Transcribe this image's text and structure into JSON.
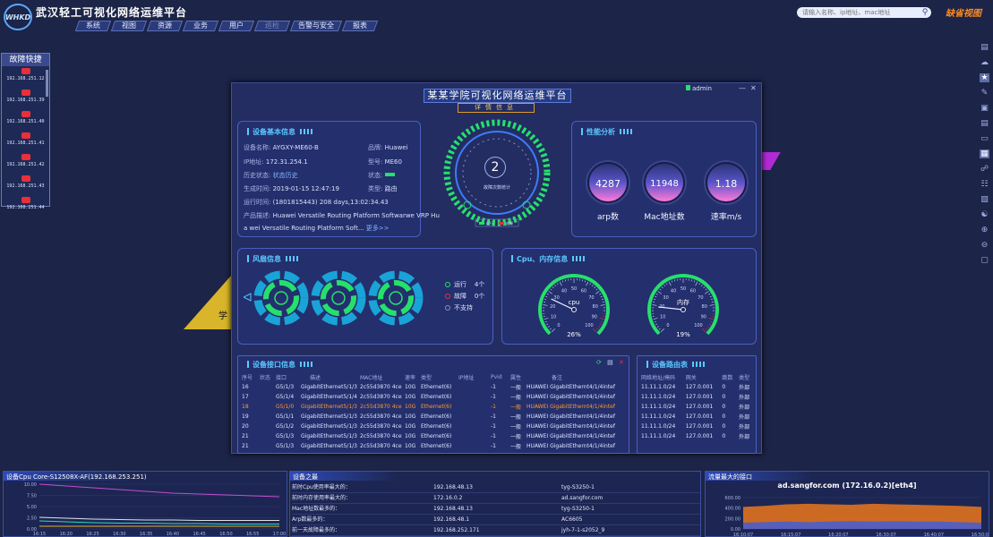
{
  "app": {
    "title": "武汉轻工可视化网络运维平台",
    "logo_text": "WHKD",
    "brand": "缺省视图",
    "search": {
      "placeholder": "请输入名称、ip地址、mac地址"
    }
  },
  "nav": [
    "系统",
    "视图",
    "资源",
    "业务",
    "用户",
    "巡检",
    "告警与安全",
    "报表"
  ],
  "quick": {
    "title": "故障快捷",
    "items": [
      "192.168.251.12",
      "192.168.251.39",
      "192.168.251.40",
      "192.168.251.41",
      "192.168.251.42",
      "192.168.251.43",
      "192.168.251.44"
    ]
  },
  "deco_text": "学",
  "modal": {
    "title": "某某学院可视化网络运维平台",
    "subtitle": "详情信息",
    "user": "admin",
    "basic": {
      "title": "设备基本信息",
      "name_k": "设备名称:",
      "name_v": "AYGXY-ME60-B",
      "brand_k": "品牌:",
      "brand_v": "Huawei",
      "ip_k": "IP地址:",
      "ip_v": "172.31.254.1",
      "model_k": "型号:",
      "model_v": "ME60",
      "hist_k": "历史状态:",
      "hist_v": "状态历史",
      "state_k": "状态:",
      "gen_k": "生成时间:",
      "gen_v": "2019-01-15 12:47:19",
      "type_k": "类型:",
      "type_v": "路由",
      "run_k": "运行时间:",
      "run_v": "(1801815443)  208 days,13:02:34.43",
      "desc_k": "产品描述:",
      "desc_v1": "Huawei Versatile Routing Platform Softwarwe VRP Hu",
      "desc_v2": "a wei Versatile Routing Platform Soft...",
      "more": "更多>>"
    },
    "center": {
      "count": "2",
      "count_label": "故障次数统计",
      "legend_run": "运行",
      "legend_fault": "故障"
    },
    "perf": {
      "title": "性能分析",
      "items": [
        {
          "value": "4287",
          "label": "arp数"
        },
        {
          "value": "11948",
          "label": "Mac地址数"
        },
        {
          "value": "1.18",
          "label": "速率m/s"
        }
      ]
    },
    "fan": {
      "title": "风扇信息",
      "legend": [
        {
          "label": "运行",
          "count": "4个",
          "color": "#26e06c"
        },
        {
          "label": "故障",
          "count": "0个",
          "color": "#e8303a"
        },
        {
          "label": "不支持",
          "count": "",
          "color": "#8a93b8"
        }
      ]
    },
    "cpumem": {
      "title": "Cpu、内存信息",
      "cpu_label": "cpu",
      "cpu_value": "26%",
      "cpu_level": 26,
      "mem_label": "内存",
      "mem_value": "19%",
      "mem_level": 19,
      "ticks": [
        "0",
        "10",
        "20",
        "30",
        "40",
        "50",
        "60",
        "70",
        "80",
        "90",
        "100"
      ]
    },
    "ports": {
      "title": "设备接口信息",
      "columns": [
        "序号",
        "状态",
        "接口",
        "描述",
        "MAC地址",
        "速率",
        "类型",
        "IP地址",
        "Pvid",
        "属性",
        "备注"
      ],
      "rows": [
        [
          "16",
          "",
          "G5/1/3",
          "GigabitEthernet5/1/3",
          "2c55d3870 4ce",
          "10G",
          "Ethernet(6)",
          "",
          "-1",
          "一般",
          "HUAWEI  GigabitEthernt4/1/4intef"
        ],
        [
          "17",
          "",
          "G5/1/4",
          "GigabitEthernet5/1/4",
          "2c55d3870 4ce",
          "10G",
          "Ethernet(6)",
          "",
          "-1",
          "一般",
          "HUAWEI  GigabitEthernt4/1/4intef"
        ],
        [
          "18",
          "",
          "G5/1/0",
          "GigabitEthernet5/1/3",
          "2c55d3870 4ce",
          "10G",
          "Ethernet(6)",
          "",
          "-1",
          "一般",
          "HUAWEI  GigabitEthernt4/1/4intef"
        ],
        [
          "19",
          "",
          "G5/1/1",
          "GigabitEthernet5/1/3",
          "2c55d3870 4ce",
          "10G",
          "Ethernet(6)",
          "",
          "-1",
          "一般",
          "HUAWEI  GigabitEthernt4/1/4intef"
        ],
        [
          "20",
          "",
          "G5/1/2",
          "GigabitEthernet5/1/3",
          "2c55d3870 4ce",
          "10G",
          "Ethernet(6)",
          "",
          "-1",
          "一般",
          "HUAWEI  GigabitEthernt4/1/4intef"
        ],
        [
          "21",
          "",
          "G5/1/3",
          "GigabitEthernet5/1/3",
          "2c55d3870 4ce",
          "10G",
          "Ethernet(6)",
          "",
          "-1",
          "一般",
          "HUAWEI  GigabitEthernt4/1/4intef"
        ],
        [
          "21",
          "",
          "G5/1/3",
          "GigabitEthernet5/1/3",
          "2c55d3870 4ce",
          "10G",
          "Ethernet(6)",
          "",
          "-1",
          "一般",
          "HUAWEI  GigabitEthernt4/1/4intef"
        ]
      ]
    },
    "routes": {
      "title": "设备路由表",
      "columns": [
        "网络地址/掩码",
        "网关",
        "跳数",
        "类型"
      ],
      "rows": [
        [
          "11.11.1.0/24",
          "127.0.001",
          "0",
          "外部"
        ],
        [
          "11.11.1.0/24",
          "127.0.001",
          "0",
          "外部"
        ],
        [
          "11.11.1.0/24",
          "127.0.001",
          "0",
          "外部"
        ],
        [
          "11.11.1.0/24",
          "127.0.001",
          "0",
          "外部"
        ],
        [
          "11.11.1.0/24",
          "127.0.001",
          "0",
          "外部"
        ],
        [
          "11.11.1.0/24",
          "127.0.001",
          "0",
          "外部"
        ]
      ]
    }
  },
  "bottom": {
    "cpu_panel": {
      "title": "设备Cpu Core-S12508X-AF(192.168.253.251)",
      "chart_data": {
        "type": "line",
        "x": [
          "16:15",
          "16:20",
          "16:25",
          "16:30",
          "16:35",
          "16:40",
          "16:45",
          "16:50",
          "16:55",
          "17:00"
        ],
        "yticks": [
          "10.00",
          "7.50",
          "5.00",
          "2.50",
          "0.00"
        ],
        "ylim": [
          0,
          10
        ],
        "series": [
          {
            "values": [
              10.0,
              9.6,
              9.2,
              8.8,
              8.4,
              8.0,
              7.8,
              7.6,
              7.4,
              7.2
            ],
            "color": "#c04fd0"
          },
          {
            "values": [
              2.6,
              2.4,
              2.2,
              2.1,
              2.0,
              2.0,
              1.9,
              1.9,
              1.9,
              1.9
            ],
            "color": "#e0e0e0"
          },
          {
            "values": [
              1.8,
              1.6,
              1.4,
              1.3,
              1.3,
              1.2,
              1.2,
              1.1,
              1.1,
              1.1
            ],
            "color": "#26e0c0"
          },
          {
            "values": [
              0.6,
              0.6,
              0.6,
              0.6,
              0.6,
              0.6,
              0.6,
              0.6,
              0.6,
              0.6
            ],
            "color": "#e0b030"
          }
        ]
      }
    },
    "alarm_panel": {
      "title": "设备之最",
      "rows": [
        [
          "前时Cpu使用率最大的：",
          "192.168.48.13",
          "tyg-S3250-1"
        ],
        [
          "前时内存使用率最大的：",
          "172.16.0.2",
          "ad.sangfor.com"
        ],
        [
          "Mac地址数最多的：",
          "192.168.48.13",
          "tyg-S3250-1"
        ],
        [
          "Arp数最多的：",
          "192.168.48.1",
          "AC6605"
        ],
        [
          "前一天故障最多的：",
          "192.168.252.171",
          "jyh-7-1-s2052_9"
        ]
      ]
    },
    "flow_panel": {
      "title": "流量最大的接口",
      "subtitle": "ad.sangfor.com (172.16.0.2)[eth4]",
      "chart_data": {
        "type": "area",
        "x": [
          "16:10:07",
          "16:15:07",
          "16:20:07",
          "16:30:07",
          "16:40:07",
          "16:50:07"
        ],
        "yticks": [
          "600.00",
          "400.00",
          "200.00",
          "0.00"
        ],
        "ylim": [
          0,
          700
        ],
        "series": [
          {
            "values": [
              420,
              440,
              470,
              480,
              470,
              460,
              480,
              470,
              460,
              450,
              440,
              420
            ],
            "color": "#e0721f"
          },
          {
            "values": [
              120,
              130,
              140,
              130,
              140,
              150,
              140,
              150,
              140,
              140,
              130,
              120
            ],
            "color": "#4a5ecc"
          }
        ]
      }
    }
  }
}
